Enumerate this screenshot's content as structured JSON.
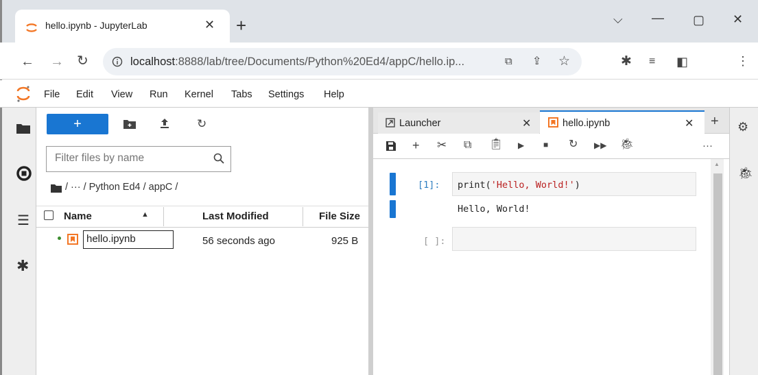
{
  "browser": {
    "tab_title": "hello.ipynb - JupyterLab",
    "url_host": "localhost",
    "url_path": ":8888/lab/tree/Documents/Python%20Ed4/appC/hello.ip...",
    "accent": "#1976d2"
  },
  "menu": [
    "File",
    "Edit",
    "View",
    "Run",
    "Kernel",
    "Tabs",
    "Settings",
    "Help"
  ],
  "filebrowser": {
    "new_label": "+",
    "filter_placeholder": "Filter files by name",
    "breadcrumb": "/ ··· / Python Ed4 / appC /",
    "columns": {
      "name": "Name",
      "modified": "Last Modified",
      "size": "File Size"
    },
    "files": [
      {
        "name": "hello.ipynb",
        "modified": "56 seconds ago",
        "size": "925 B"
      }
    ]
  },
  "notebook": {
    "tabs": [
      {
        "label": "Launcher",
        "icon": "launcher-icon"
      },
      {
        "label": "hello.ipynb",
        "icon": "notebook-icon"
      }
    ],
    "more": "···",
    "cells": [
      {
        "prompt": "[1]:",
        "code_fn": "print(",
        "code_str": "'Hello, World!'",
        "code_end": ")",
        "output": "Hello, World!"
      },
      {
        "prompt": "[ ]:",
        "code_fn": "",
        "code_str": "",
        "code_end": "",
        "output": ""
      }
    ]
  }
}
